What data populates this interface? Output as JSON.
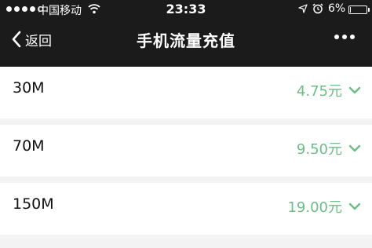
{
  "status_bar": {
    "carrier": "中国移动",
    "time": "23:33",
    "battery_percent_text": "6%",
    "battery_level": 0.06,
    "signal_bars_filled": 4,
    "signal_bars_total": 5
  },
  "nav": {
    "back_label": "返回",
    "title": "手机流量充值"
  },
  "items": [
    {
      "name": "30M",
      "price": "4.75元"
    },
    {
      "name": "70M",
      "price": "9.50元"
    },
    {
      "name": "150M",
      "price": "19.00元"
    }
  ],
  "colors": {
    "header_bg": "#1b1b1b",
    "price_green": "#6dbd85",
    "page_bg": "#f3f3f3"
  }
}
